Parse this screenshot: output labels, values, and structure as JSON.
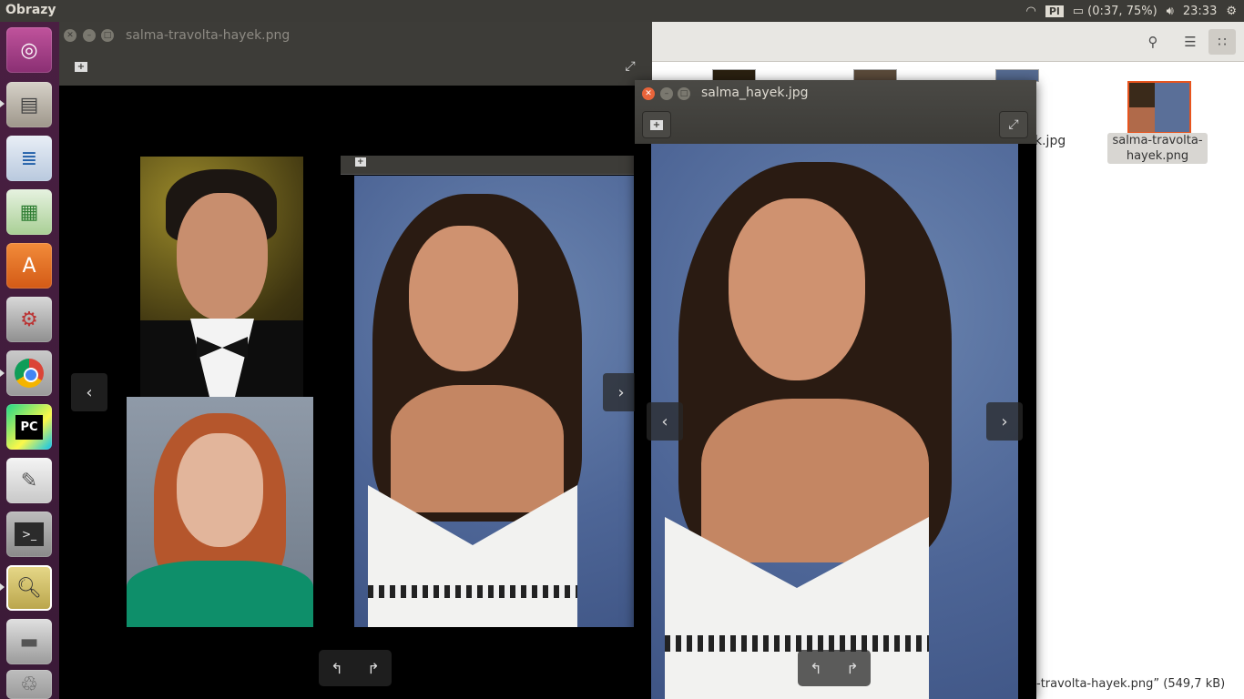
{
  "topbar": {
    "app_name": "Obrazy",
    "keyboard_layout": "Pl",
    "battery": "(0:37, 75%)",
    "clock": "23:33"
  },
  "launcher": {
    "items": [
      "ubuntu-logo",
      "files",
      "writer",
      "calc",
      "software-center",
      "system-settings",
      "chrome",
      "pycharm",
      "text-editor",
      "terminal",
      "image-viewer",
      "disk",
      "trash"
    ]
  },
  "files_window": {
    "selected_file_label": "salma-travolta-hayek.png",
    "partial_file_label": "k.jpg",
    "status": "-travolta-hayek.png” (549,7 kB)"
  },
  "viewer1": {
    "title": "salma-travolta-hayek.png"
  },
  "viewer2": {
    "title": "salma_hayek.jpg"
  },
  "controls": {
    "prev": "‹",
    "next": "›",
    "rotate_left": "↰",
    "rotate_right": "↱",
    "add": "+",
    "fullscreen": "⤢"
  }
}
